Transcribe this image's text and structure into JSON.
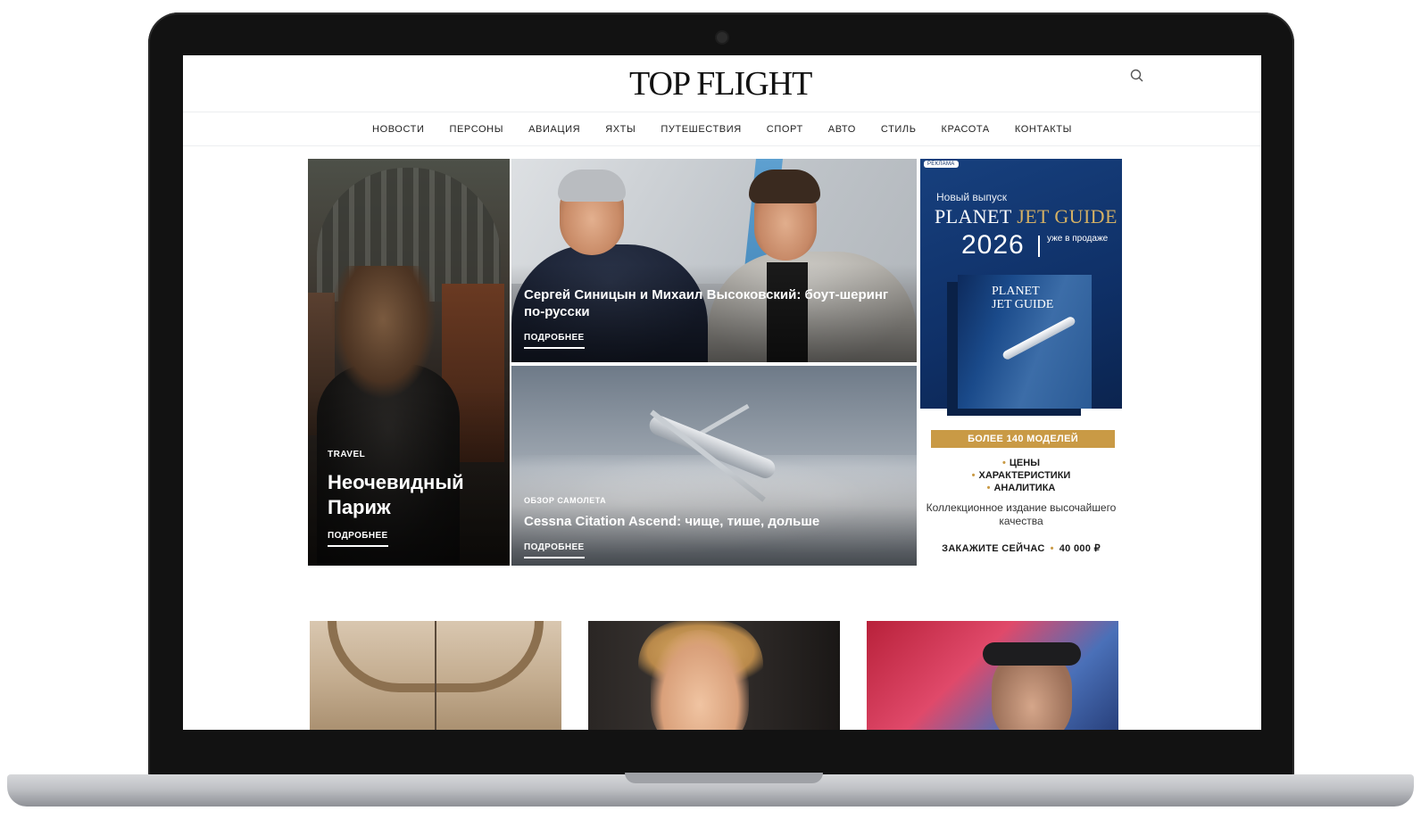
{
  "site": {
    "logo": "TOP FLIGHT",
    "search_icon": "search-icon"
  },
  "nav": {
    "items": [
      {
        "label": "НОВОСТИ"
      },
      {
        "label": "ПЕРСОНЫ"
      },
      {
        "label": "АВИАЦИЯ"
      },
      {
        "label": "ЯХТЫ"
      },
      {
        "label": "ПУТЕШЕСТВИЯ"
      },
      {
        "label": "СПОРТ"
      },
      {
        "label": "АВТО"
      },
      {
        "label": "СТИЛЬ"
      },
      {
        "label": "КРАСОТА"
      },
      {
        "label": "КОНТАКТЫ"
      }
    ]
  },
  "hero": {
    "left": {
      "category": "TRAVEL",
      "title": "Неочевидный Париж",
      "more": "ПОДРОБНЕЕ"
    },
    "top": {
      "title": "Сергей Синицын и Михаил Высоковский: боут-шеринг по-русски",
      "more": "ПОДРОБНЕЕ"
    },
    "bottom": {
      "category": "ОБЗОР САМОЛЕТА",
      "title": "Cessna Citation Ascend: чище, тише, дольше",
      "more": "ПОДРОБНЕЕ"
    }
  },
  "ad": {
    "badge": "РЕКЛАМА",
    "kicker": "Новый выпуск",
    "brand_white": "PLANET ",
    "brand_gold": "JET GUIDE",
    "year": "2026",
    "availability": "уже в продаже",
    "book_title_1": "PLANET",
    "book_title_2": "JET GUIDE",
    "strip": "БОЛЕЕ 140 МОДЕЛЕЙ",
    "list": [
      "ЦЕНЫ",
      "ХАРАКТЕРИСТИКИ",
      "АНАЛИТИКА"
    ],
    "description": "Коллекционное издание высочайшего качества",
    "cta_label": "ЗАКАЖИТЕ СЕЙЧАС",
    "cta_price": "40 000 ₽",
    "colors": {
      "navy": "#0f3067",
      "gold": "#c99a45"
    }
  }
}
